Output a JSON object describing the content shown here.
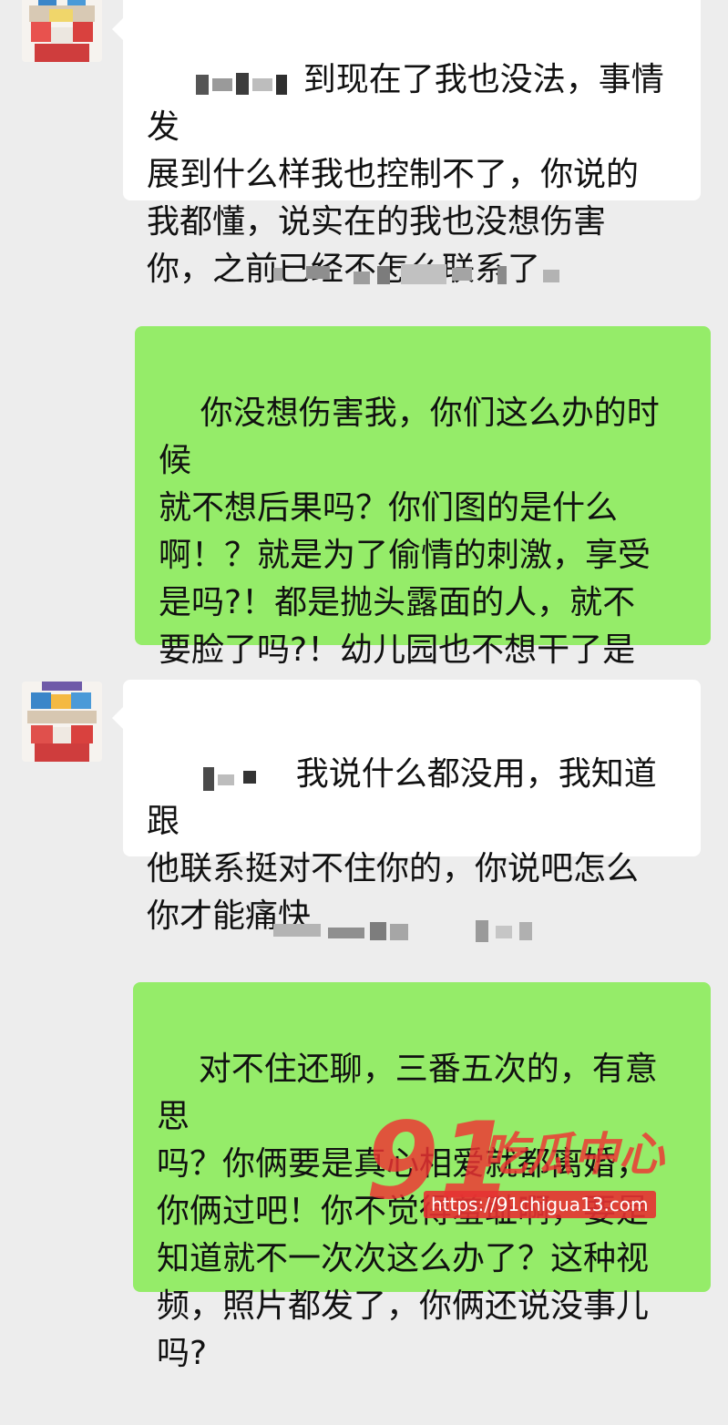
{
  "messages": [
    {
      "side": "in",
      "text": "到现在了我也没法，事情发\n展到什么样我也控制不了，你说的\n我都懂，说实在的我也没想伤害\n你，之前已经不怎么联系了"
    },
    {
      "side": "out",
      "text": "你没想伤害我，你们这么办的时候\n就不想后果吗？你们图的是什么\n啊！？就是为了偷情的刺激，享受\n是吗?！都是抛头露面的人，就不\n要脸了吗?！幼儿园也不想干了是\n吗?"
    },
    {
      "side": "in",
      "text": "我说什么都没用，我知道跟\n他联系挺对不住你的，你说吧怎么\n你才能痛快"
    },
    {
      "side": "out",
      "text": "对不住还聊，三番五次的，有意思\n吗？你俩要是真心相爱就都离婚，\n你俩过吧！你不觉得羞耻啊，要是\n知道就不一次次这么办了？这种视\n频，照片都发了，你俩还说没事儿\n吗?"
    }
  ],
  "watermark": {
    "logo": "91",
    "text": "吃瓜中心",
    "url": "https://91chigua13.com"
  },
  "colors": {
    "background": "#ededed",
    "incoming_bubble": "#ffffff",
    "outgoing_bubble": "#95ec69",
    "watermark": "#ef3232"
  }
}
